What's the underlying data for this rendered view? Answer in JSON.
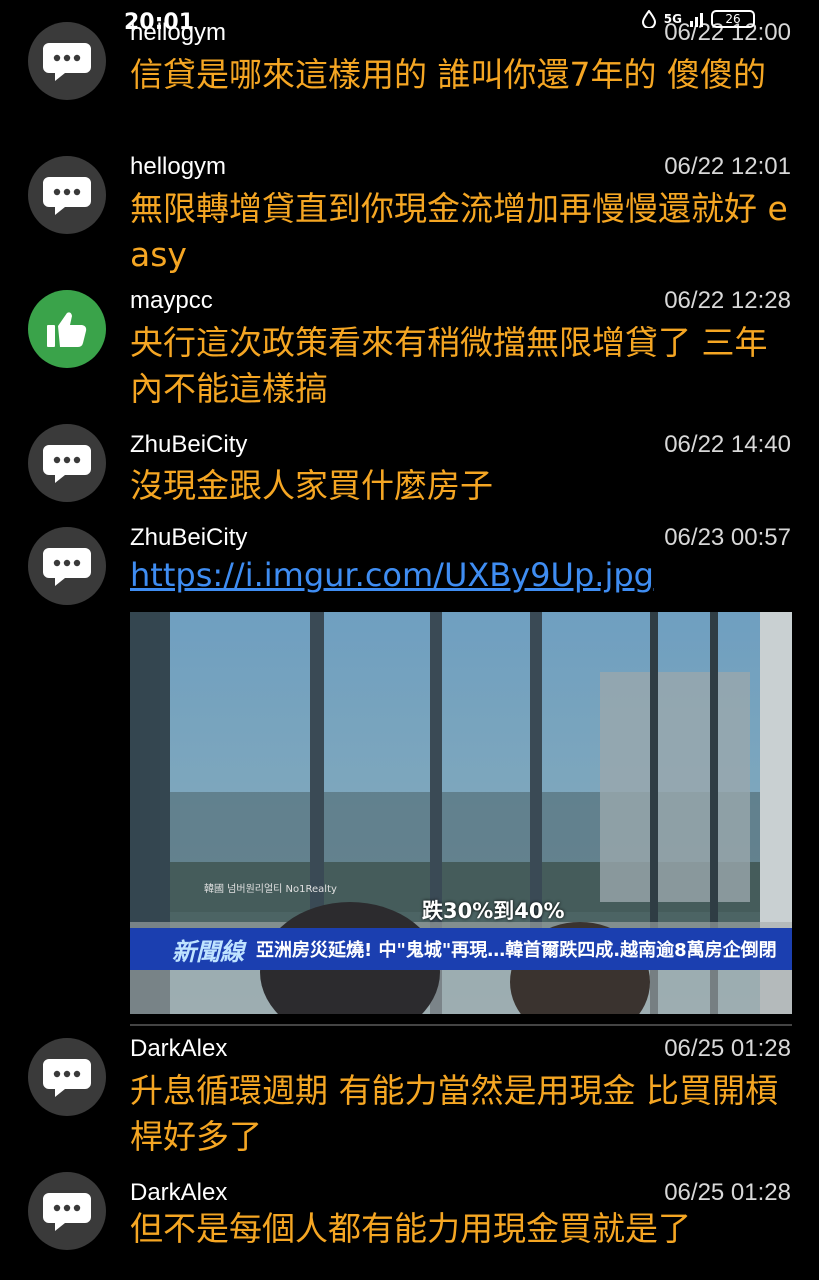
{
  "status_bar": {
    "time": "20:01",
    "network": "5G",
    "battery": "26",
    "icons": [
      "water-drop-icon",
      "signal-icon",
      "battery-icon"
    ]
  },
  "colors": {
    "background": "#000000",
    "message": "#f5a623",
    "link": "#3f8df2",
    "like_avatar": "#3aa34a",
    "neutral_avatar": "#3a3a3a"
  },
  "comments": [
    {
      "user": "hellogym",
      "time": "06/22 12:00",
      "icon": "comment-icon",
      "text": "信貸是哪來這樣用的 誰叫你還7年的 傻傻的"
    },
    {
      "user": "hellogym",
      "time": "06/22 12:01",
      "icon": "comment-icon",
      "text": "無限轉增貸直到你現金流增加再慢慢還就好 easy"
    },
    {
      "user": "maypcc",
      "time": "06/22 12:28",
      "icon": "thumbs-up-icon",
      "text": "央行這次政策看來有稍微擋無限增貸了 三年內不能這樣搞"
    },
    {
      "user": "ZhuBeiCity",
      "time": "06/22 14:40",
      "icon": "comment-icon",
      "text": "沒現金跟人家買什麼房子"
    },
    {
      "user": "ZhuBeiCity",
      "time": "06/23 00:57",
      "icon": "comment-icon",
      "link": "https://i.imgur.com/UXBy9Up.jpg"
    },
    {
      "user": "DarkAlex",
      "time": "06/25 01:28",
      "icon": "comment-icon",
      "text": "升息循環週期 有能力當然是用現金 比買開槓桿好多了"
    },
    {
      "user": "DarkAlex",
      "time": "06/25 01:28",
      "icon": "comment-icon",
      "text": "但不是每個人都有能力用現金買就是了"
    }
  ],
  "news_image": {
    "watermark": "韓國 넘버원리얼티 No1Realty",
    "caption": "跌30%到40%",
    "logo": "新聞線",
    "ticker": "亞洲房災延燒! 中\"鬼城\"再現…韓首爾跌四成.越南逾8萬房企倒閉"
  }
}
